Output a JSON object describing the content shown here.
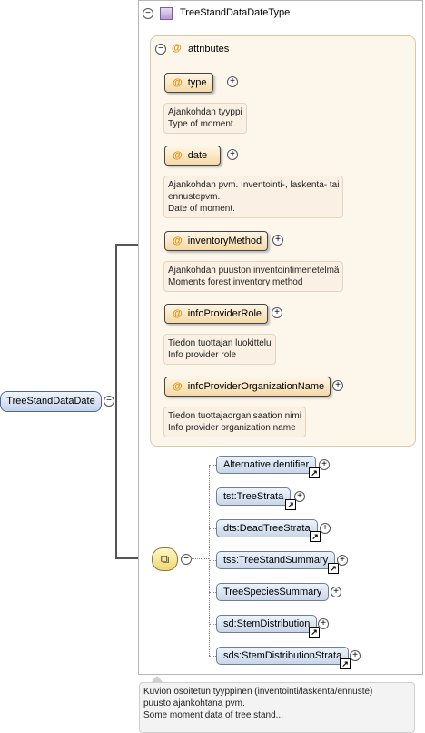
{
  "root": {
    "label": "TreeStandDataDate"
  },
  "type_header": {
    "label": "TreeStandDataDateType"
  },
  "attributes_header": {
    "label": "attributes"
  },
  "attributes": [
    {
      "name": "type",
      "doc_line1": "Ajankohdan tyyppi",
      "doc_line2": "Type of moment.",
      "doc_line3": ""
    },
    {
      "name": "date",
      "doc_line1": "Ajankohdan pvm. Inventointi-, laskenta- tai",
      "doc_line2": "ennustepvm.",
      "doc_line3": "Date of moment."
    },
    {
      "name": "inventoryMethod",
      "doc_line1": "Ajankohdan puuston inventointimenetelmä",
      "doc_line2": "Moments forest inventory method",
      "doc_line3": ""
    },
    {
      "name": "infoProviderRole",
      "doc_line1": "Tiedon tuottajan luokittelu",
      "doc_line2": "Info provider role",
      "doc_line3": ""
    },
    {
      "name": "infoProviderOrganizationName",
      "doc_line1": "Tiedon tuottajaorganisaation nimi",
      "doc_line2": "Info provider organization name",
      "doc_line3": ""
    }
  ],
  "elements": [
    {
      "label": "AlternativeIdentifier",
      "ref": true
    },
    {
      "label": "tst:TreeStrata",
      "ref": true
    },
    {
      "label": "dts:DeadTreeStrata",
      "ref": true
    },
    {
      "label": "tss:TreeStandSummary",
      "ref": true
    },
    {
      "label": "TreeSpeciesSummary",
      "ref": false
    },
    {
      "label": "sd:StemDistribution",
      "ref": true
    },
    {
      "label": "sds:StemDistributionStrata",
      "ref": true
    }
  ],
  "bottom_doc": {
    "line1": "Kuvion osoitetun tyyppinen (inventointi/laskenta/ennuste)",
    "line2": "puusto ajankohtana pvm.",
    "line3": "Some moment data of tree stand..."
  },
  "icons": {
    "collapse": "collapse-icon",
    "expand": "expand-icon",
    "reference": "reference-arrow-icon",
    "sequence": "sequence-icon",
    "attribute": "attribute-at-icon",
    "complex_type": "complex-type-icon"
  }
}
